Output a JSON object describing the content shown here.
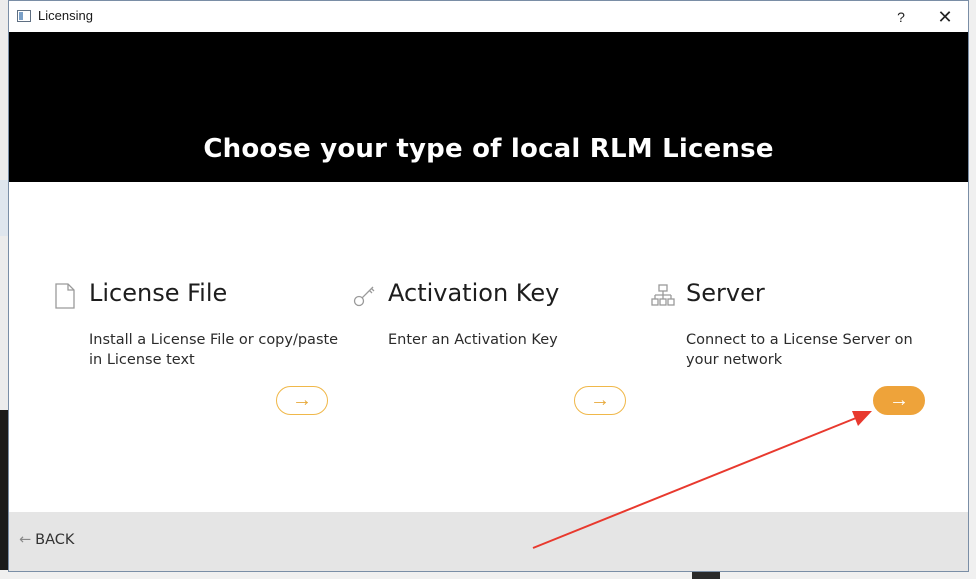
{
  "window": {
    "title": "Licensing",
    "help_label": "?",
    "close_label": "✕"
  },
  "banner": {
    "heading": "Choose your type of local RLM License"
  },
  "options": [
    {
      "title": "License File",
      "description": "Install a License File or copy/paste in License text",
      "icon": "document-icon",
      "arrow": "→"
    },
    {
      "title": "Activation Key",
      "description": "Enter an Activation Key",
      "icon": "key-icon",
      "arrow": "→"
    },
    {
      "title": "Server",
      "description": "Connect to a License Server on your network",
      "icon": "network-icon",
      "arrow": "→"
    }
  ],
  "footer": {
    "back_arrow": "←",
    "back_label": "BACK"
  },
  "colors": {
    "accent": "#eea33a",
    "banner": "#000000",
    "footer": "#e5e5e5",
    "annotation_arrow": "#e8392e"
  }
}
